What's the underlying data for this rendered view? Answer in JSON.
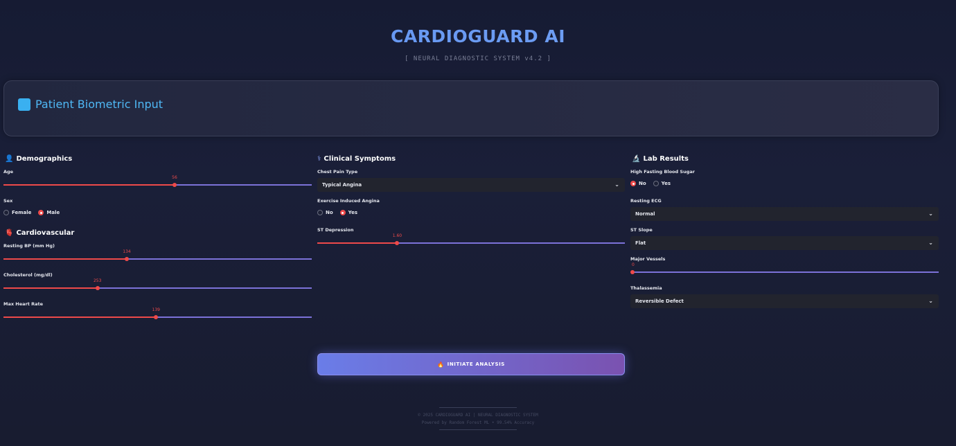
{
  "header": {
    "title": "CARDIOGUARD AI",
    "subtitle": "[ NEURAL DIAGNOSTIC SYSTEM v4.2 ]"
  },
  "panel": {
    "title": "Patient Biometric Input",
    "accent": "#3ab0f0"
  },
  "demographics": {
    "heading": "Demographics",
    "icon": "person-icon",
    "age": {
      "label": "Age",
      "value": "56",
      "fraction": 0.555
    },
    "sex": {
      "label": "Sex",
      "options": [
        "Female",
        "Male"
      ],
      "selected": "Male"
    }
  },
  "cardio": {
    "heading": "Cardiovascular",
    "icon": "heart-icon",
    "bp": {
      "label": "Resting BP (mm Hg)",
      "value": "134",
      "fraction": 0.4
    },
    "chol": {
      "label": "Cholesterol (mg/dl)",
      "value": "253",
      "fraction": 0.305
    },
    "hr": {
      "label": "Max Heart Rate",
      "value": "139",
      "fraction": 0.495
    }
  },
  "clinical": {
    "heading": "Clinical Symptoms",
    "icon": "stethoscope-icon",
    "chest": {
      "label": "Chest Pain Type",
      "value": "Typical Angina"
    },
    "angina": {
      "label": "Exercise Induced Angina",
      "options": [
        "No",
        "Yes"
      ],
      "selected": "Yes"
    },
    "st": {
      "label": "ST Depression",
      "value": "1.60",
      "fraction": 0.26
    }
  },
  "lab": {
    "heading": "Lab Results",
    "icon": "microscope-icon",
    "fbs": {
      "label": "High Fasting Blood Sugar",
      "options": [
        "No",
        "Yes"
      ],
      "selected": "No"
    },
    "ecg": {
      "label": "Resting ECG",
      "value": "Normal"
    },
    "slope": {
      "label": "ST Slope",
      "value": "Flat"
    },
    "vessels": {
      "label": "Major Vessels",
      "value": "0",
      "fraction": 0.0
    },
    "thal": {
      "label": "Thalassemia",
      "value": "Reversible Defect"
    }
  },
  "action": {
    "label": "INITIATE ANALYSIS",
    "icon": "flame-icon"
  },
  "footer": {
    "line1": "© 2025 CARDIOGUARD AI | NEURAL DIAGNOSTIC SYSTEM",
    "line2": "Powered by Random Forest ML • 99.54% Accuracy"
  }
}
